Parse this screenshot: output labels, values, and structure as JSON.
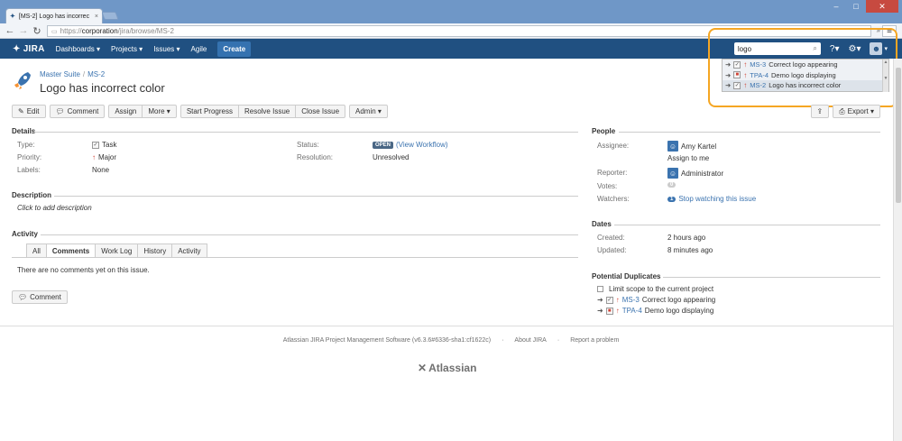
{
  "browser": {
    "tab_title": "[MS-2] Logo has incorrec",
    "url_scheme": "https://",
    "url_host": "corporation",
    "url_path": "/jira/browse/MS-2",
    "ext_label": "»"
  },
  "header": {
    "logo": "JIRA",
    "nav": [
      "Dashboards ▾",
      "Projects ▾",
      "Issues ▾",
      "Agile"
    ],
    "create_label": "Create",
    "search_value": "logo"
  },
  "quick_search": [
    {
      "key": "MS-3",
      "summary": "Correct logo appearing"
    },
    {
      "key": "TPA-4",
      "summary": "Demo logo displaying"
    },
    {
      "key": "MS-2",
      "summary": "Logo has incorrect color"
    }
  ],
  "issue": {
    "project": "Master Suite",
    "key": "MS-2",
    "title": "Logo has incorrect color"
  },
  "ops": {
    "edit": "Edit",
    "comment": "Comment",
    "assign": "Assign",
    "more": "More ▾",
    "start_progress": "Start Progress",
    "resolve": "Resolve Issue",
    "close": "Close Issue",
    "admin": "Admin ▾",
    "export": "Export ▾"
  },
  "details": {
    "title": "Details",
    "type_label": "Type:",
    "type_value": "Task",
    "priority_label": "Priority:",
    "priority_value": "Major",
    "labels_label": "Labels:",
    "labels_value": "None",
    "status_label": "Status:",
    "status_value": "OPEN",
    "view_workflow": "(View Workflow)",
    "resolution_label": "Resolution:",
    "resolution_value": "Unresolved"
  },
  "description": {
    "title": "Description",
    "placeholder": "Click to add description"
  },
  "activity": {
    "title": "Activity",
    "tabs": [
      "All",
      "Comments",
      "Work Log",
      "History",
      "Activity"
    ],
    "empty": "There are no comments yet on this issue.",
    "comment_btn": "Comment"
  },
  "people": {
    "title": "People",
    "assignee_label": "Assignee:",
    "assignee": "Amy Kartel",
    "assign_to_me": "Assign to me",
    "reporter_label": "Reporter:",
    "reporter": "Administrator",
    "votes_label": "Votes:",
    "votes": "0",
    "watchers_label": "Watchers:",
    "watchers_count": "1",
    "stop_watching": "Stop watching this issue"
  },
  "dates": {
    "title": "Dates",
    "created_label": "Created:",
    "created": "2 hours ago",
    "updated_label": "Updated:",
    "updated": "8 minutes ago"
  },
  "duplicates": {
    "title": "Potential Duplicates",
    "limit_label": "Limit scope to the current project",
    "items": [
      {
        "key": "MS-3",
        "summary": "Correct logo appearing"
      },
      {
        "key": "TPA-4",
        "summary": "Demo logo displaying"
      }
    ]
  },
  "footer": {
    "software": "Atlassian JIRA Project Management Software (v6.3.6#6336-sha1:cf1622c)",
    "about": "About JIRA",
    "report": "Report a problem",
    "logo": "Atlassian"
  },
  "colors": {
    "header_bg": "#205081",
    "link": "#3b73af",
    "highlight": "#f5a623",
    "priority": "#d04437"
  }
}
